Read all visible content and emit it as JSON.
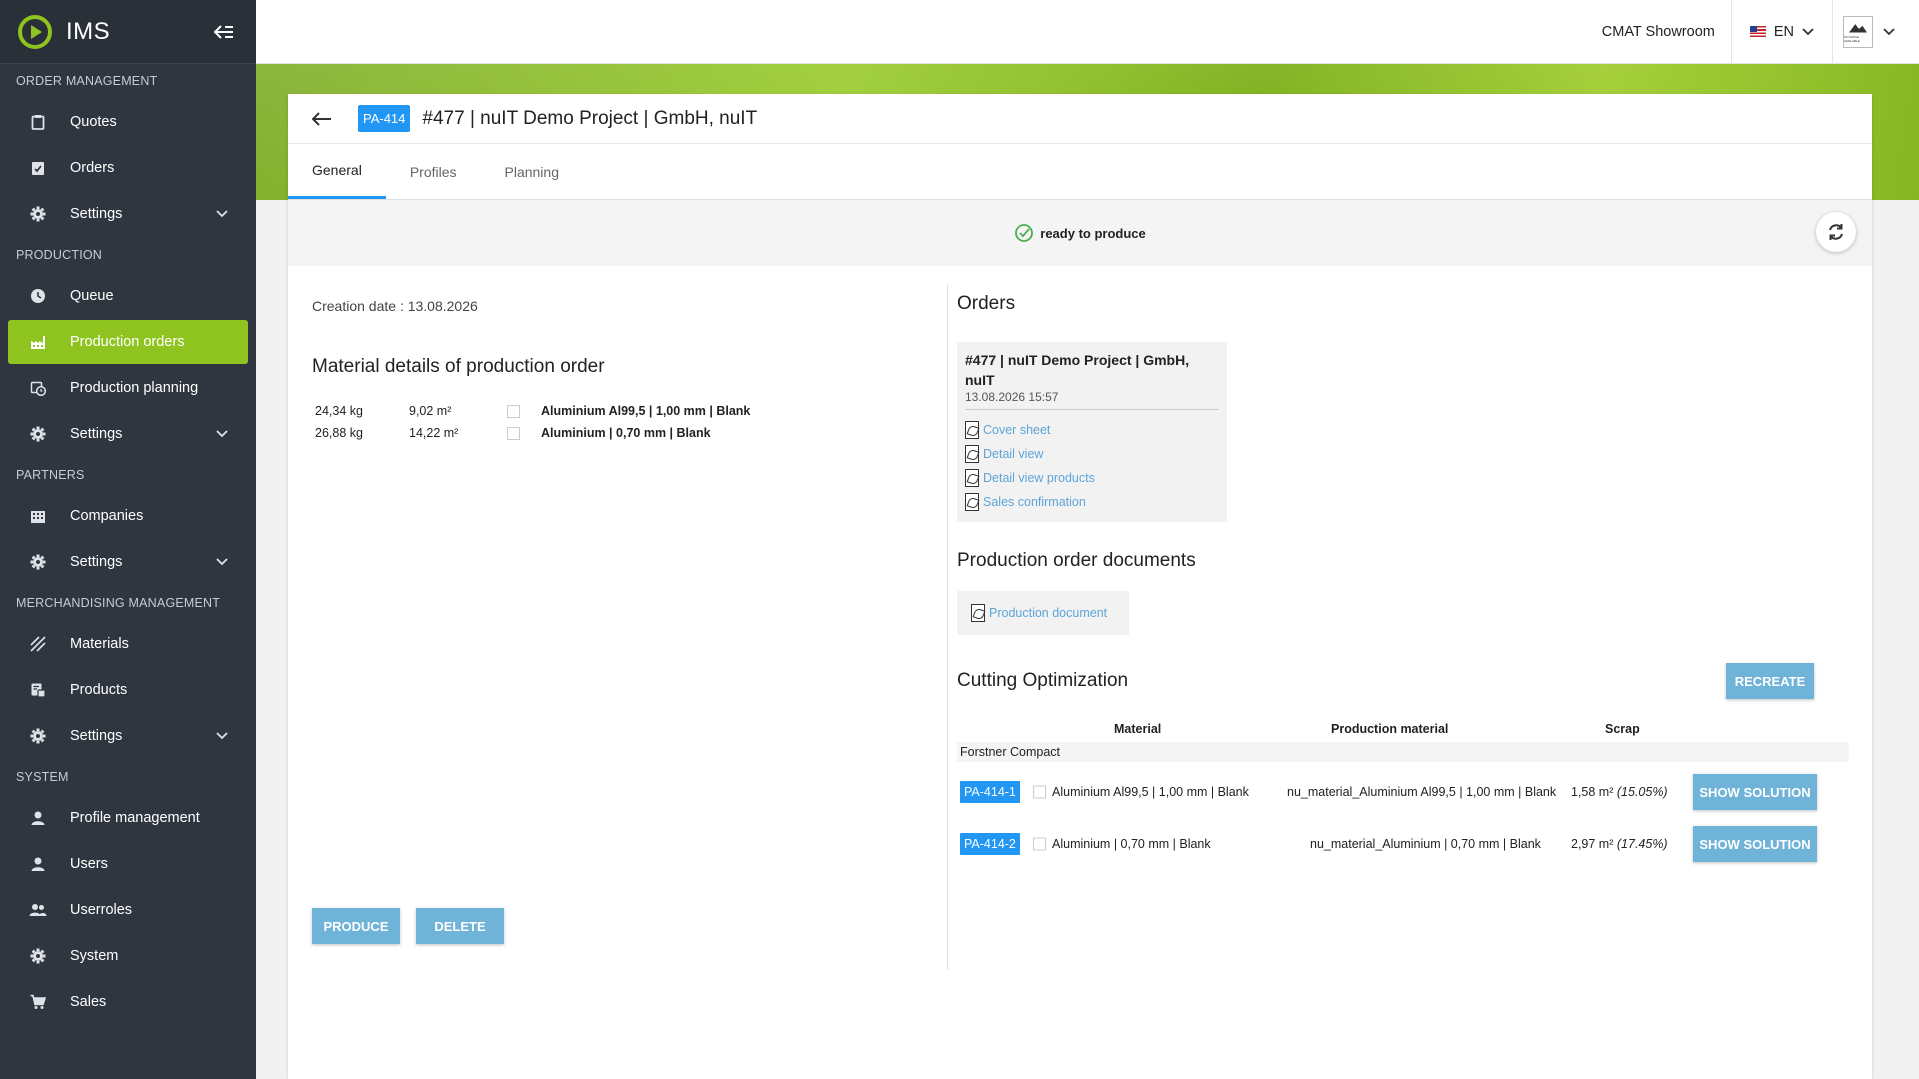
{
  "app": {
    "name": "IMS"
  },
  "sidebar": {
    "sections": [
      {
        "title": "ORDER MANAGEMENT",
        "items": [
          {
            "label": "Quotes",
            "icon": "clipboard-icon"
          },
          {
            "label": "Orders",
            "icon": "clipboard-check-icon"
          },
          {
            "label": "Settings",
            "icon": "gear-icon",
            "expandable": true
          }
        ]
      },
      {
        "title": "PRODUCTION",
        "items": [
          {
            "label": "Queue",
            "icon": "clock-icon"
          },
          {
            "label": "Production orders",
            "icon": "factory-icon",
            "active": true
          },
          {
            "label": "Production planning",
            "icon": "calendar-clock-icon"
          },
          {
            "label": "Settings",
            "icon": "gear-icon",
            "expandable": true
          }
        ]
      },
      {
        "title": "PARTNERS",
        "items": [
          {
            "label": "Companies",
            "icon": "building-icon"
          },
          {
            "label": "Settings",
            "icon": "gear-icon",
            "expandable": true
          }
        ]
      },
      {
        "title": "MERCHANDISING MANAGEMENT",
        "items": [
          {
            "label": "Materials",
            "icon": "hatch-icon"
          },
          {
            "label": "Products",
            "icon": "product-icon"
          },
          {
            "label": "Settings",
            "icon": "gear-icon",
            "expandable": true
          }
        ]
      },
      {
        "title": "SYSTEM",
        "items": [
          {
            "label": "Profile management",
            "icon": "user-icon"
          },
          {
            "label": "Users",
            "icon": "user-icon"
          },
          {
            "label": "Userroles",
            "icon": "users-icon"
          },
          {
            "label": "System",
            "icon": "gear-icon"
          },
          {
            "label": "Sales",
            "icon": "cart-icon"
          }
        ]
      }
    ]
  },
  "topbar": {
    "company": "CMAT Showroom",
    "language": "EN",
    "avatar_text": "NO IMAGE AVAILABLE"
  },
  "header": {
    "badge": "PA-414",
    "title": "#477 | nuIT Demo Project | GmbH, nuIT"
  },
  "tabs": [
    {
      "label": "General",
      "active": true
    },
    {
      "label": "Profiles"
    },
    {
      "label": "Planning"
    }
  ],
  "status": {
    "text": "ready to produce"
  },
  "general": {
    "creation_date": "Creation date : 13.08.2026",
    "material_title": "Material details of production order",
    "materials": [
      {
        "weight": "24,34 kg",
        "area": "9,02 m²",
        "name": "Aluminium Al99,5 | 1,00 mm | Blank"
      },
      {
        "weight": "26,88 kg",
        "area": "14,22 m²",
        "name": "Aluminium | 0,70 mm | Blank"
      }
    ]
  },
  "orders": {
    "title": "Orders",
    "items": [
      {
        "title": "#477 | nuIT Demo Project | GmbH, nuIT",
        "date": "13.08.2026 15:57",
        "docs": [
          "Cover sheet",
          "Detail view",
          "Detail view products",
          "Sales confirmation"
        ]
      }
    ]
  },
  "po_docs": {
    "title": "Production order documents",
    "items": [
      "Production document"
    ]
  },
  "cutting": {
    "title": "Cutting Optimization",
    "recreate_label": "RECREATE",
    "headers": {
      "material": "Material",
      "production_material": "Production material",
      "scrap": "Scrap"
    },
    "group": "Forstner Compact",
    "rows": [
      {
        "badge": "PA-414-1",
        "material": "Aluminium Al99,5 | 1,00 mm | Blank",
        "production_material": "nu_material_Aluminium Al99,5 | 1,00 mm | Blank",
        "scrap": "1,58 m²",
        "scrap_pct": "(15.05%)",
        "button": "SHOW SOLUTION"
      },
      {
        "badge": "PA-414-2",
        "material": "Aluminium | 0,70 mm | Blank",
        "production_material": "nu_material_Aluminium | 0,70 mm | Blank",
        "scrap": "2,97 m²",
        "scrap_pct": "(17.45%)",
        "button": "SHOW SOLUTION"
      }
    ]
  },
  "actions": {
    "produce": "PRODUCE",
    "delete": "DELETE"
  }
}
